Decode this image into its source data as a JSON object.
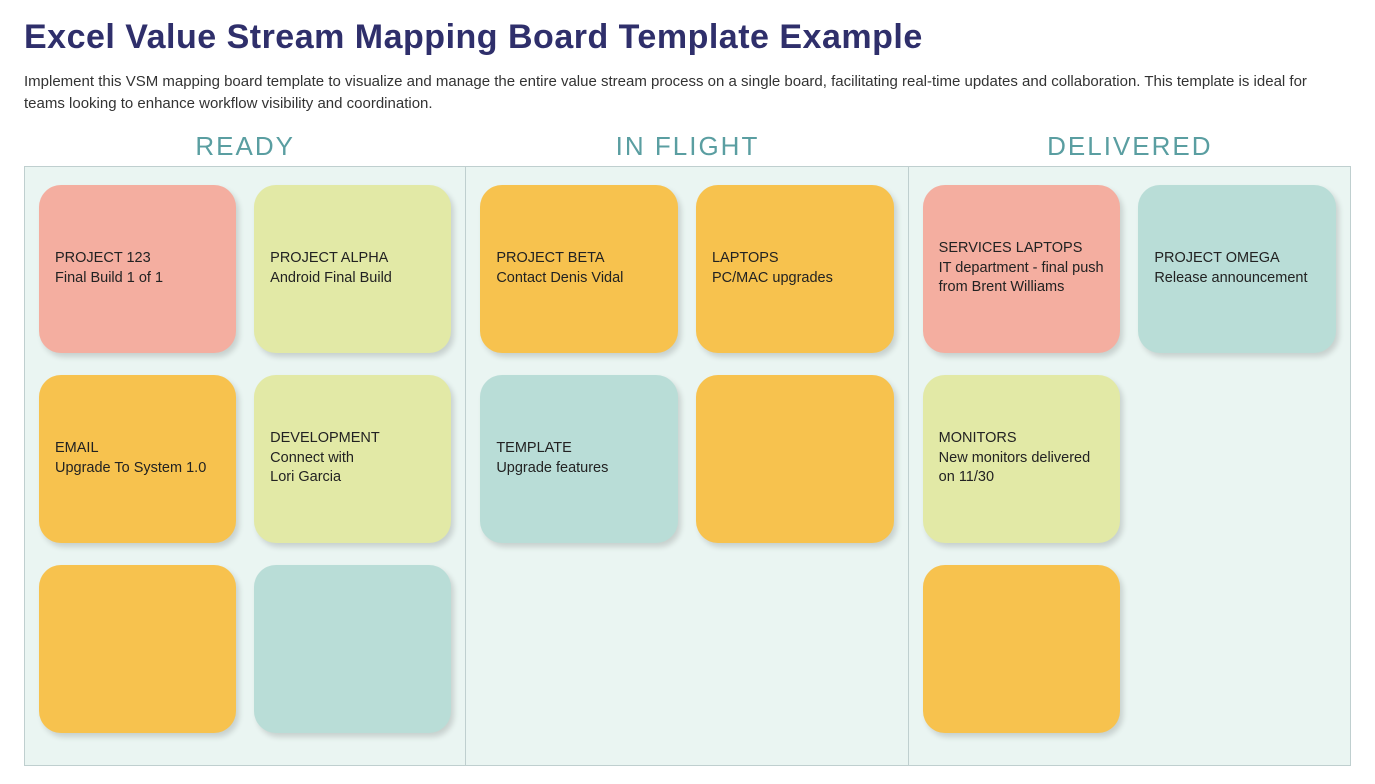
{
  "title": "Excel Value Stream Mapping Board Template Example",
  "description": "Implement this VSM mapping board template to visualize and manage the entire value stream process on a single board, facilitating real-time updates and collaboration. This template is ideal for teams looking to enhance workflow visibility and coordination.",
  "columns": {
    "ready": {
      "label": "READY",
      "cards": [
        {
          "title": "PROJECT 123",
          "sub": "Final Build 1 of 1",
          "color": "c-salmon"
        },
        {
          "title": "PROJECT ALPHA",
          "sub": "Android Final Build",
          "color": "c-lime"
        },
        {
          "title": "EMAIL",
          "sub": "Upgrade To System 1.0",
          "color": "c-orange"
        },
        {
          "title": "DEVELOPMENT",
          "sub": "Connect with\nLori Garcia",
          "color": "c-lime"
        },
        {
          "title": "",
          "sub": "",
          "color": "c-orange"
        },
        {
          "title": "",
          "sub": "",
          "color": "c-teal"
        }
      ]
    },
    "inflight": {
      "label": "IN FLIGHT",
      "cards": [
        {
          "title": "PROJECT BETA",
          "sub": "Contact Denis Vidal",
          "color": "c-orange"
        },
        {
          "title": "LAPTOPS",
          "sub": "PC/MAC upgrades",
          "color": "c-orange"
        },
        {
          "title": "TEMPLATE",
          "sub": "Upgrade features",
          "color": "c-teal"
        },
        {
          "title": "",
          "sub": "",
          "color": "c-orange"
        }
      ]
    },
    "delivered": {
      "label": "DELIVERED",
      "cards": [
        {
          "title": "SERVICES LAPTOPS",
          "sub": "IT department - final push from Brent Williams",
          "color": "c-salmon"
        },
        {
          "title": "PROJECT OMEGA",
          "sub": "Release announcement",
          "color": "c-teal"
        },
        {
          "title": "MONITORS",
          "sub": "New monitors delivered on 11/30",
          "color": "c-lime"
        },
        {
          "title": "",
          "sub": "",
          "color": "",
          "empty": true
        },
        {
          "title": "",
          "sub": "",
          "color": "c-orange"
        }
      ]
    }
  }
}
